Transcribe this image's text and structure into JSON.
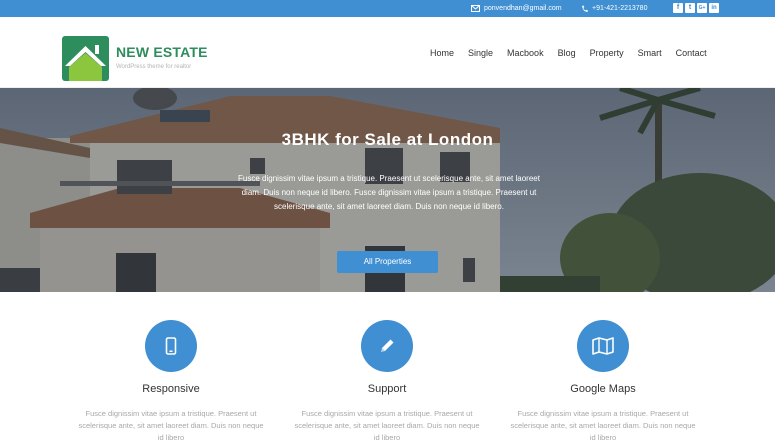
{
  "topbar": {
    "email": "ponvendhan@gmail.com",
    "phone": "+91-421-2213780",
    "socials": [
      {
        "icon": "facebook-icon",
        "glyph": "f"
      },
      {
        "icon": "twitter-icon",
        "glyph": "t"
      },
      {
        "icon": "google-plus-icon",
        "glyph": "G+"
      },
      {
        "icon": "linkedin-icon",
        "glyph": "in"
      }
    ]
  },
  "brand": {
    "name": "NEW ESTATE",
    "tagline": "WordPress theme for realtor",
    "colors": {
      "green": "#2e8d5c",
      "lime": "#8cc63f"
    }
  },
  "nav": [
    "Home",
    "Single",
    "Macbook",
    "Blog",
    "Property",
    "Smart",
    "Contact"
  ],
  "hero": {
    "title": "3BHK for Sale at London",
    "description": "Fusce dignissim vitae ipsum a tristique. Praesent ut scelerisque ante, sit amet laoreet diam. Duis non neque id libero. Fusce dignissim vitae ipsum a tristique. Praesent ut scelerisque ante, sit amet laoreet diam. Duis non neque id libero.",
    "button": "All Properties"
  },
  "features": [
    {
      "icon": "mobile-icon",
      "title": "Responsive",
      "description": "Fusce dignissim vitae ipsum a tristique. Praesent ut scelerisque ante, sit amet laoreet diam. Duis non neque id libero"
    },
    {
      "icon": "pencil-icon",
      "title": "Support",
      "description": "Fusce dignissim vitae ipsum a tristique. Praesent ut scelerisque ante, sit amet laoreet diam. Duis non neque id libero"
    },
    {
      "icon": "map-icon",
      "title": "Google Maps",
      "description": "Fusce dignissim vitae ipsum a tristique. Praesent ut scelerisque ante, sit amet laoreet diam. Duis non neque id libero"
    }
  ],
  "colors": {
    "accent": "#3f8fd2",
    "text": "#333333",
    "muted": "#a8a8a8"
  }
}
